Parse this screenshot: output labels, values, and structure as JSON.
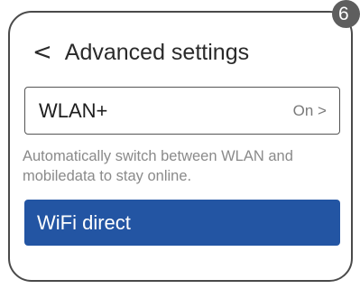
{
  "step_badge": "6",
  "header": {
    "back_icon": "<",
    "title": "Advanced settings"
  },
  "wlan_plus": {
    "label": "WLAN+",
    "status": "On >",
    "description": "Automatically switch between WLAN and mobiledata to stay online."
  },
  "wifi_direct": {
    "label": "WiFi direct",
    "highlight_color": "#2355a3"
  }
}
